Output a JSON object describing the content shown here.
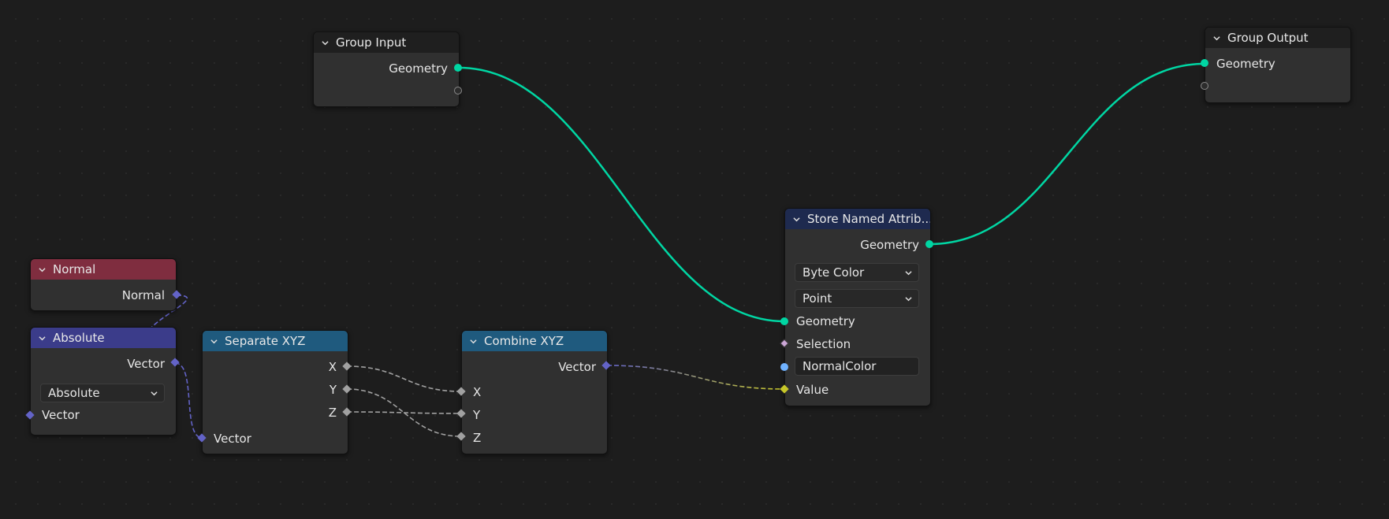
{
  "nodes": {
    "group_input": {
      "title": "Group Input",
      "outputs": [
        "Geometry"
      ]
    },
    "group_output": {
      "title": "Group Output",
      "inputs": [
        "Geometry"
      ]
    },
    "normal": {
      "title": "Normal",
      "outputs": [
        "Normal"
      ]
    },
    "absolute": {
      "title": "Absolute",
      "outputs": [
        "Vector"
      ],
      "operation": "Absolute",
      "inputs": [
        "Vector"
      ]
    },
    "separate_xyz": {
      "title": "Separate XYZ",
      "outputs": [
        "X",
        "Y",
        "Z"
      ],
      "inputs": [
        "Vector"
      ]
    },
    "combine_xyz": {
      "title": "Combine XYZ",
      "outputs": [
        "Vector"
      ],
      "inputs": [
        "X",
        "Y",
        "Z"
      ]
    },
    "store_named_attribute": {
      "title": "Store Named Attrib...",
      "outputs": [
        "Geometry"
      ],
      "data_type": "Byte Color",
      "domain": "Point",
      "inputs": [
        "Geometry",
        "Selection"
      ],
      "name_value": "NormalColor",
      "value_label": "Value"
    }
  },
  "socket_colors": {
    "geometry": "#00d6a3",
    "vector": "#6363c7",
    "float": "#a1a1a1",
    "boolean": "#cca6d6",
    "string": "#70b2ff",
    "color": "#c7c729"
  },
  "header_colors": {
    "group": "#1f1f1f",
    "input": "#7f2d3f",
    "vector_math": "#3b3c8a",
    "converter": "#1f5a7e",
    "attribute": "#1e2a4f"
  }
}
